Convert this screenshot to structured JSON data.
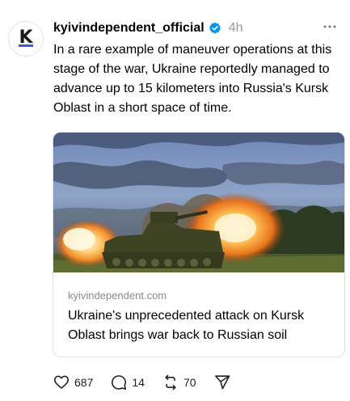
{
  "post": {
    "username": "kyivindependent_official",
    "timestamp": "4h",
    "avatar_letter": "K",
    "text": "In a rare example of maneuver operations at this stage of the war, Ukraine reportedly managed to advance up to 15 kilometers into Russia's Kursk Oblast in a short space of time."
  },
  "link_card": {
    "domain": "kyivindependent.com",
    "title": "Ukraine's unprecedented attack on Kursk Oblast brings war back to Russian soil"
  },
  "actions": {
    "likes": "687",
    "replies": "14",
    "reposts": "70"
  },
  "colors": {
    "verified": "#0095f6",
    "avatar_accent": "#2f5fd6"
  },
  "icons": [
    "verified-badge-icon",
    "more-options-icon",
    "heart-icon",
    "comment-icon",
    "repost-icon",
    "share-icon"
  ]
}
